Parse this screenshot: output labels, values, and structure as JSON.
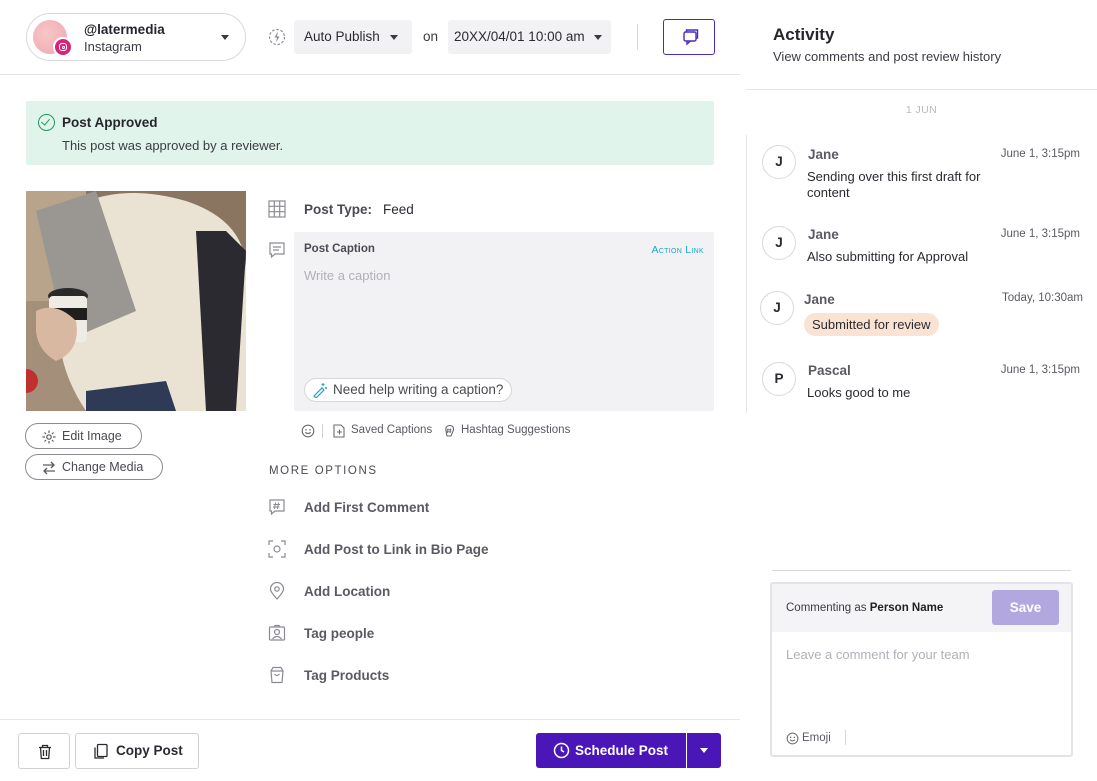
{
  "account": {
    "handle": "@latermedia",
    "platform": "Instagram"
  },
  "publish": {
    "mode": "Auto Publish",
    "on_label": "on",
    "datetime": "20XX/04/01 10:00 am"
  },
  "banner": {
    "title": "Post Approved",
    "text": "This post was approved by a reviewer."
  },
  "media_actions": {
    "edit": "Edit Image",
    "change": "Change Media"
  },
  "post_type": {
    "label": "Post Type:",
    "value": "Feed"
  },
  "caption": {
    "label": "Post Caption",
    "action_link": "Action Link",
    "placeholder": "Write a caption",
    "help": "Need help writing a caption?"
  },
  "caption_tools": {
    "saved": "Saved Captions",
    "hashtags": "Hashtag Suggestions"
  },
  "more_options": {
    "title": "MORE OPTIONS",
    "items": [
      "Add First Comment",
      "Add Post to Link in Bio Page",
      "Add Location",
      "Tag people",
      "Tag Products"
    ]
  },
  "footer": {
    "copy": "Copy Post",
    "schedule": "Schedule Post"
  },
  "activity": {
    "title": "Activity",
    "subtitle": "View comments and post review history",
    "date_separator": "1 JUN",
    "comments": [
      {
        "initial": "J",
        "name": "Jane",
        "time": "June 1, 3:15pm",
        "text": "Sending over this first draft for content"
      },
      {
        "initial": "J",
        "name": "Jane",
        "time": "June 1, 3:15pm",
        "text": "Also submitting for Approval"
      },
      {
        "initial": "J",
        "name": "Jane",
        "time": "Today, 10:30am",
        "badge": "Submitted for review"
      },
      {
        "initial": "P",
        "name": "Pascal",
        "time": "June 1, 3:15pm",
        "text": "Looks good to me"
      }
    ]
  },
  "composer": {
    "commenting_prefix": "Commenting as",
    "person": "Person Name",
    "save": "Save",
    "placeholder": "Leave a comment for your team",
    "emoji": "Emoji"
  },
  "colors": {
    "brand": "#4a16b8",
    "success_bg": "#e1f4eb",
    "success": "#1f9a5b",
    "instagram": "#d6237c",
    "link": "#1ca4c7"
  }
}
